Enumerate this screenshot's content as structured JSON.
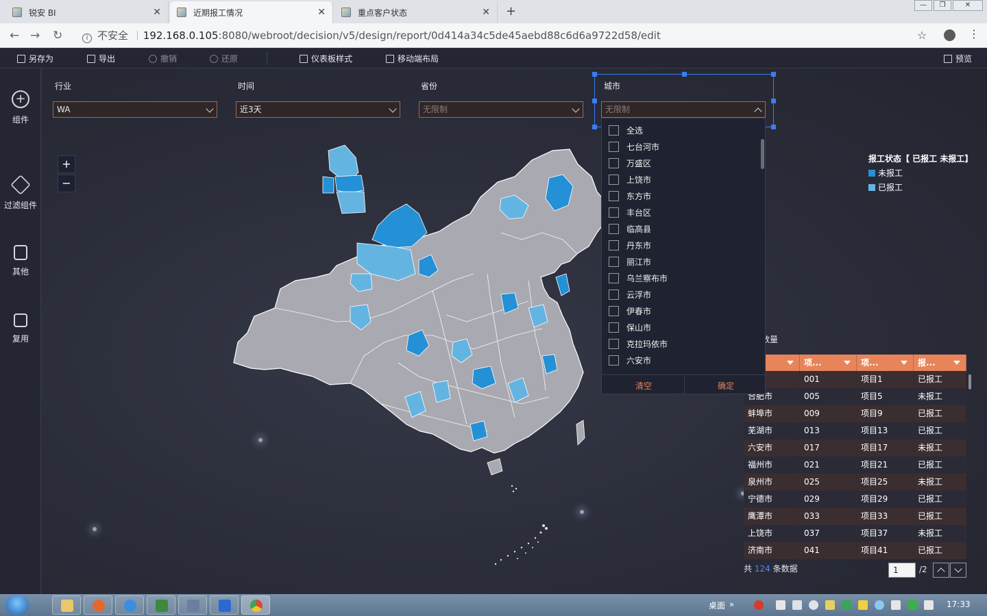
{
  "browser": {
    "tabs": [
      {
        "title": "锐安 BI"
      },
      {
        "title": "近期报工情况"
      },
      {
        "title": "重点客户状态"
      }
    ],
    "security_label": "不安全",
    "url_host": "192.168.0.105",
    "url_rest": ":8080/webroot/decision/v5/design/report/0d414a34c5de45aebd88c6d6a9722d58/edit"
  },
  "toolbar": {
    "save_as": "另存为",
    "export": "导出",
    "undo": "撤销",
    "redo": "还原",
    "dashboard_style": "仪表板样式",
    "mobile_layout": "移动端布局",
    "preview": "预览"
  },
  "sidebar": {
    "items": [
      {
        "label": "组件",
        "icon": "add-circle-icon"
      },
      {
        "label": "过滤组件",
        "icon": "cube-icon"
      },
      {
        "label": "其他",
        "icon": "document-icon"
      },
      {
        "label": "复用",
        "icon": "copy-icon"
      }
    ]
  },
  "filters": {
    "industry": {
      "label": "行业",
      "value": "WA"
    },
    "time": {
      "label": "时间",
      "value": "近3天"
    },
    "province": {
      "label": "省份",
      "placeholder": "无限制"
    },
    "city": {
      "label": "城市",
      "placeholder": "无限制"
    }
  },
  "city_dropdown": {
    "options": [
      "全选",
      "七台河市",
      "万盛区",
      "上饶市",
      "东方市",
      "丰台区",
      "临高县",
      "丹东市",
      "丽江市",
      "乌兰察布市",
      "云浮市",
      "伊春市",
      "保山市",
      "克拉玛依市",
      "六安市"
    ],
    "clear": "清空",
    "confirm": "确定"
  },
  "map": {
    "zoom_in": "+",
    "zoom_out": "−",
    "legend": {
      "title": "报工状态【 已报工 未报工】",
      "items": [
        {
          "label": "未报工",
          "color": "#2490d6"
        },
        {
          "label": "已报工",
          "color": "#64b4e2"
        }
      ]
    },
    "region_colors": {
      "base": "#a9a9b1",
      "unreported": "#2490d6",
      "reported": "#64b4e2"
    }
  },
  "table": {
    "title": "数量",
    "headers": [
      "城...",
      "项...",
      "项...",
      "报..."
    ],
    "rows": [
      [
        "…市",
        "001",
        "项目1",
        "已报工"
      ],
      [
        "合肥市",
        "005",
        "项目5",
        "未报工"
      ],
      [
        "蚌埠市",
        "009",
        "项目9",
        "已报工"
      ],
      [
        "芜湖市",
        "013",
        "项目13",
        "已报工"
      ],
      [
        "六安市",
        "017",
        "项目17",
        "未报工"
      ],
      [
        "福州市",
        "021",
        "项目21",
        "已报工"
      ],
      [
        "泉州市",
        "025",
        "项目25",
        "未报工"
      ],
      [
        "宁德市",
        "029",
        "项目29",
        "已报工"
      ],
      [
        "鹰潭市",
        "033",
        "项目33",
        "已报工"
      ],
      [
        "上饶市",
        "037",
        "项目37",
        "未报工"
      ],
      [
        "济南市",
        "041",
        "项目41",
        "已报工"
      ]
    ],
    "pager": {
      "prefix": "共",
      "count": "124",
      "suffix": "条数据",
      "page": "1",
      "total": "/2"
    }
  },
  "taskbar": {
    "desktop": "桌面",
    "time": "17:33"
  }
}
